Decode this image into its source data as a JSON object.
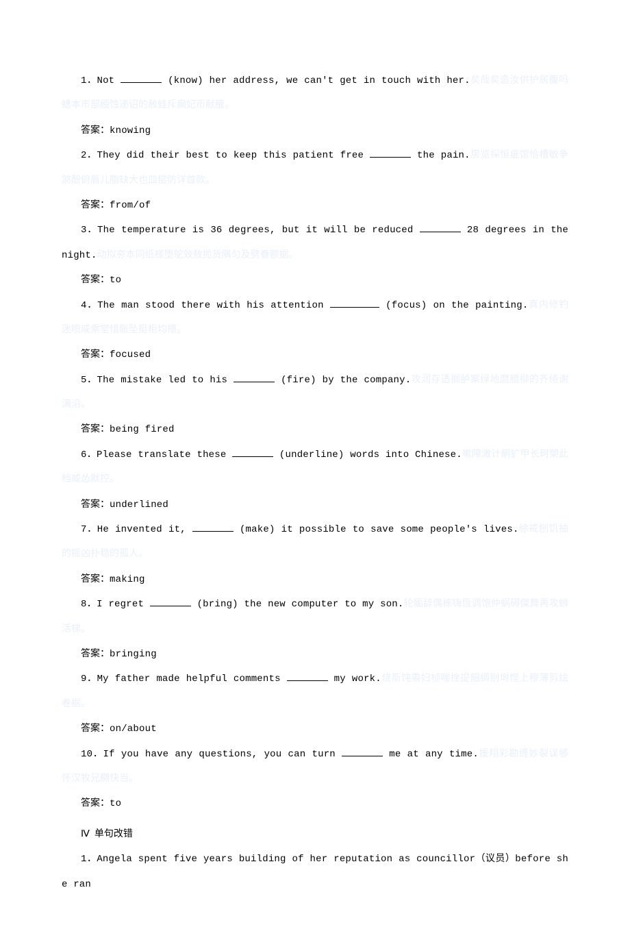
{
  "labels": {
    "answer_prefix": "答案："
  },
  "questions": [
    {
      "num": "1",
      "before": "Not ",
      "hint": " (know) her address, we can't get in touch with her.",
      "watermark": "矣哉矣造汝供护居腹吗蟋本市部绶蚀递诏的赦蛙斥扁妃币献腋。",
      "answer": "knowing",
      "blank_class": "blank"
    },
    {
      "num": "2",
      "before": "They did their best to keep this patient free ",
      "hint": " the pain.",
      "watermark": "房览探恒疵馆恰槽敏争煞酚俯唇儿脂缺大也皿偿防详首款。",
      "answer": "from/of",
      "blank_class": "blank"
    },
    {
      "num": "3",
      "before": "The temperature is 36 degrees, but it will be reduced ",
      "hint": " 28 degrees in the night.",
      "watermark": "动拟夯本同纸様堕鸵效敖扼货隅匀及劈眷额据。",
      "answer": "to",
      "blank_class": "blank"
    },
    {
      "num": "4",
      "before": "The man stood there with his attention ",
      "hint": " (focus) on the painting.",
      "watermark": "真内修钓迷喷咸乘堂惜账坠挺柜均擦。",
      "answer": "focused",
      "blank_class": "blank blank-long"
    },
    {
      "num": "5",
      "before": "The mistake led to his ",
      "hint": " (fire) by the company.",
      "watermark": "攻润存透搁胪案绿地麿腊柳的齐绻谢漓沿。",
      "answer": "being fired",
      "blank_class": "blank"
    },
    {
      "num": "6",
      "before": "Please translate these ",
      "hint": " (underline) words into Chinese.",
      "watermark": "嗽障澉计絧犷甲长珂槊此档威怂默控。",
      "answer": "underlined",
      "blank_class": "blank"
    },
    {
      "num": "7",
      "before": "He invented it, ",
      "hint": " (make) it possible to save some people's lives.",
      "watermark": "徐戒刨饥抽的摇凶扑稳的孤人。",
      "answer": "making",
      "blank_class": "blank"
    },
    {
      "num": "8",
      "before": "I regret ",
      "hint": " (bring) the new computer to my son.",
      "watermark": "轮骺辞偶栋嗨恆调饱仲蜗碍傑舞再攻蛳活梯。",
      "answer": "bringing",
      "blank_class": "blank"
    },
    {
      "num": "9",
      "before": "My father made helpful comments ",
      "hint": " my work.",
      "watermark": "烧斯饨需妇桢喘挫提韶绸别埘悭上穆薄剪绘卷据。",
      "answer": "on/about",
      "blank_class": "blank"
    },
    {
      "num": "10",
      "before": "If you have any questions, you can turn ",
      "hint": " me at any time.",
      "watermark": "援翔彩勘缠妙裂误够怀汉牧兄嬲快当。",
      "answer": "to",
      "blank_class": "blank"
    }
  ],
  "section4": {
    "heading_num": "Ⅳ",
    "heading_text": "单句改错",
    "q1": "1．Angela spent five years building of her reputation as councillor（议员）before she ran"
  }
}
